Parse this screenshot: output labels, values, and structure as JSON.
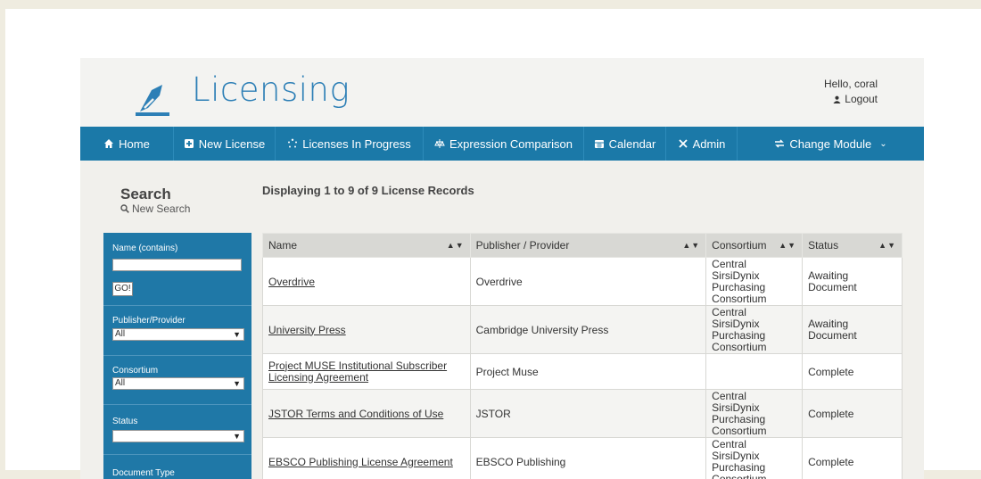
{
  "app": {
    "title": "Licensing"
  },
  "user": {
    "greeting": "Hello, coral",
    "logout_label": "Logout"
  },
  "nav": {
    "items": [
      {
        "label": "Home",
        "icon": "home-icon"
      },
      {
        "label": "New License",
        "icon": "plus-square-icon"
      },
      {
        "label": "Licenses In Progress",
        "icon": "spinner-icon"
      },
      {
        "label": "Expression Comparison",
        "icon": "compare-icon"
      },
      {
        "label": "Calendar",
        "icon": "calendar-icon"
      },
      {
        "label": "Admin",
        "icon": "tools-icon"
      },
      {
        "label": "Change Module",
        "icon": "swap-icon"
      }
    ]
  },
  "search": {
    "title": "Search",
    "new_search_label": "New Search"
  },
  "results": {
    "summary": "Displaying 1 to 9 of 9 License Records"
  },
  "filters": {
    "name_label": "Name (contains)",
    "name_value": "",
    "go_label": "GO!",
    "publisher_label": "Publisher/Provider",
    "publisher_value": "All",
    "consortium_label": "Consortium",
    "consortium_value": "All",
    "status_label": "Status",
    "status_value": "",
    "doctype_label": "Document Type"
  },
  "table": {
    "columns": [
      "Name",
      "Publisher / Provider",
      "Consortium",
      "Status"
    ],
    "rows": [
      {
        "name": "Overdrive",
        "publisher": "Overdrive",
        "consortium": "Central SirsiDynix Purchasing Consortium",
        "status": "Awaiting Document"
      },
      {
        "name": "University Press",
        "publisher": "Cambridge University Press",
        "consortium": "Central SirsiDynix Purchasing Consortium",
        "status": "Awaiting Document"
      },
      {
        "name": "Project MUSE Institutional Subscriber Licensing Agreement",
        "publisher": "Project Muse",
        "consortium": "",
        "status": "Complete"
      },
      {
        "name": "JSTOR Terms and Conditions of Use",
        "publisher": "JSTOR",
        "consortium": "Central SirsiDynix Purchasing Consortium",
        "status": "Complete"
      },
      {
        "name": "EBSCO Publishing License Agreement",
        "publisher": "EBSCO Publishing",
        "consortium": "Central SirsiDynix Purchasing Consortium",
        "status": "Complete"
      }
    ]
  },
  "colors": {
    "brand": "#2d7fb6",
    "nav": "#1b79a8",
    "sidebar": "#1f78a7"
  }
}
